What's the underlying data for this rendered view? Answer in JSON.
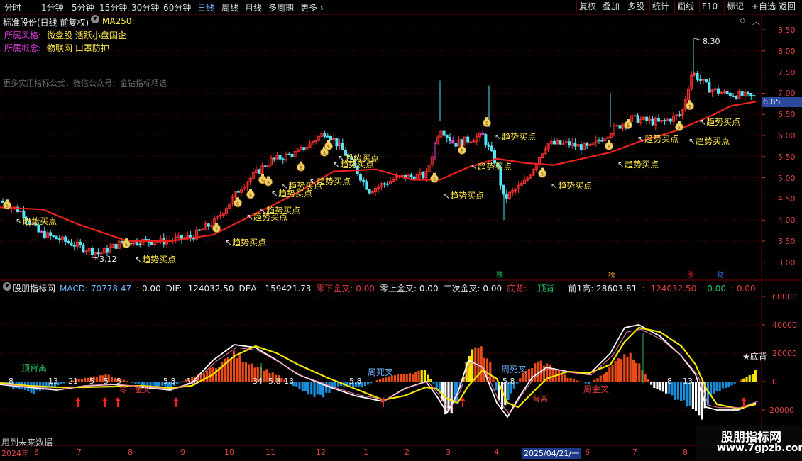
{
  "toolbar": {
    "left": [
      "分时",
      "1分钟",
      "5分钟",
      "15分钟",
      "30分钟",
      "60分钟",
      "日线",
      "周线",
      "月线",
      "多周期",
      "更多 ›"
    ],
    "active": "日线",
    "right": [
      "复权",
      "叠加",
      "多股",
      "统计",
      "画线",
      "F10",
      "标记",
      "+自选",
      "返回"
    ]
  },
  "main": {
    "title": "标准股份(日线 前复权)",
    "ma_label": "MA250:",
    "style_label": "所属风格:",
    "style_value": "微盘股 活跃小盘国企",
    "concept_label": "所属概念:",
    "concept_value": "物联网 口罩防护",
    "promo": "更多实用指标公式，微信公众号：金钻指标精选",
    "price_labels": [
      "8.50",
      "8.00",
      "7.50",
      "7.00",
      "6.50",
      "6.00",
      "5.50",
      "5.00",
      "4.50",
      "4.00",
      "3.50",
      "3.00"
    ],
    "current_price": "6.65",
    "high_label": "8.30",
    "low_label": "3.12",
    "buy_label": "趋势买点",
    "badges": [
      {
        "t": "跌",
        "c": "#1aa84a"
      },
      {
        "t": "榜",
        "c": "#d48a2b"
      },
      {
        "t": "涨",
        "c": "#d21e1e"
      },
      {
        "t": "财",
        "c": "#2a6bd8"
      }
    ]
  },
  "indicator": {
    "name": "股朋指标网",
    "values": [
      {
        "t": "MACD: 70778.47",
        "c": "#6fb6ff"
      },
      {
        "t": ": 0.00",
        "c": "#e8e8e8"
      },
      {
        "t": "DIF: -124032.50",
        "c": "#e8e8e8"
      },
      {
        "t": "DEA: -159421.73",
        "c": "#e8e8e8"
      },
      {
        "t": "零下金叉: 0.00",
        "c": "#e03c3c"
      },
      {
        "t": "零上金叉: 0.00",
        "c": "#e8e8e8"
      },
      {
        "t": "二次金叉: 0.00",
        "c": "#e8e8e8"
      },
      {
        "t": "底背: -",
        "c": "#e03c3c"
      },
      {
        "t": "顶背: -",
        "c": "#22c060"
      },
      {
        "t": "前1高: 28603.81",
        "c": "#e8e8e8"
      },
      {
        "t": ": -124032.50",
        "c": "#e03c3c"
      },
      {
        "t": ": 0.00",
        "c": "#22c060"
      },
      {
        "t": ": 0.00",
        "c": "#e03c3c"
      }
    ],
    "y_labels": [
      "60000",
      "40000",
      "20000",
      "0",
      "-20000"
    ],
    "labels": {
      "top_div": "顶背离",
      "zhousi1": "周死叉",
      "zhousi2": "周死叉",
      "zhoujin": "周金叉",
      "dibei": "★底背",
      "qijin": "零下金叉",
      "fanbei": "背离",
      "future": "用到未来数据"
    }
  },
  "timeline": [
    "2024年",
    "6",
    "7",
    "8",
    "9",
    "10",
    "11",
    "12",
    "1",
    "2",
    "3",
    "4",
    "2025/04/21/一",
    "6",
    "7",
    "8"
  ],
  "watermark": {
    "title": "股朋指标网",
    "url": "www.7gpzb.com"
  }
}
